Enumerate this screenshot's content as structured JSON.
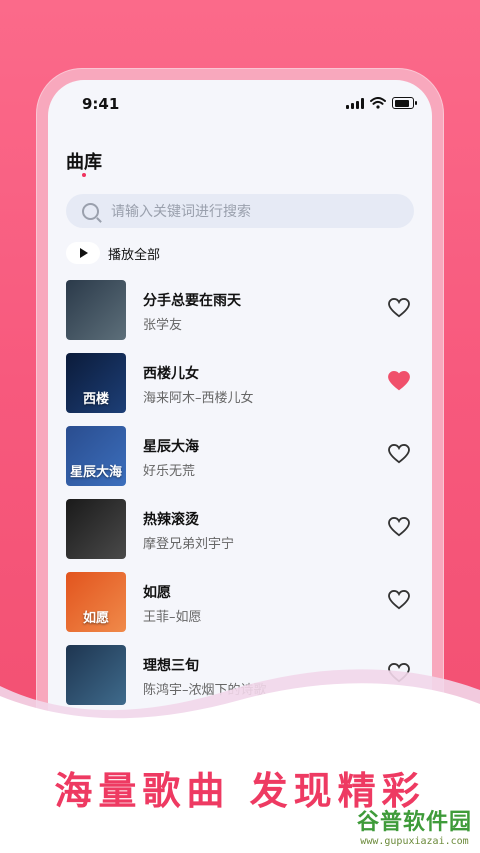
{
  "status_bar": {
    "time": "9:41"
  },
  "header": {
    "title": "曲库"
  },
  "search": {
    "placeholder": "请输入关键词进行搜索"
  },
  "play_all": {
    "label": "播放全部"
  },
  "songs": [
    {
      "title": "分手总要在雨天",
      "artist": "张学友",
      "liked": false,
      "cover_text": "",
      "cover_colors": [
        "#2b3a4a",
        "#5d6f7a"
      ]
    },
    {
      "title": "西楼儿女",
      "artist": "海来阿木–西楼儿女",
      "liked": true,
      "cover_text": "西楼",
      "cover_colors": [
        "#0b1b3a",
        "#1d3f77"
      ]
    },
    {
      "title": "星辰大海",
      "artist": "好乐无荒",
      "liked": false,
      "cover_text": "星辰大海",
      "cover_colors": [
        "#2a4d8f",
        "#3c6fbd"
      ]
    },
    {
      "title": "热辣滚烫",
      "artist": "摩登兄弟刘宇宁",
      "liked": false,
      "cover_text": "",
      "cover_colors": [
        "#1a1a1a",
        "#4a4a4a"
      ]
    },
    {
      "title": "如愿",
      "artist": "王菲–如愿",
      "liked": false,
      "cover_text": "如愿",
      "cover_colors": [
        "#e2541e",
        "#f08a4a"
      ]
    },
    {
      "title": "理想三旬",
      "artist": "陈鸿宇–浓烟下的诗歌",
      "liked": false,
      "cover_text": "",
      "cover_colors": [
        "#1e3550",
        "#3f6b8c"
      ]
    }
  ],
  "tagline": "海量歌曲 发现精彩",
  "colors": {
    "accent": "#ee3a62",
    "heart_liked": "#f0506b"
  },
  "watermark": {
    "name": "谷普软件园",
    "url": "www.gupuxiazai.com"
  }
}
